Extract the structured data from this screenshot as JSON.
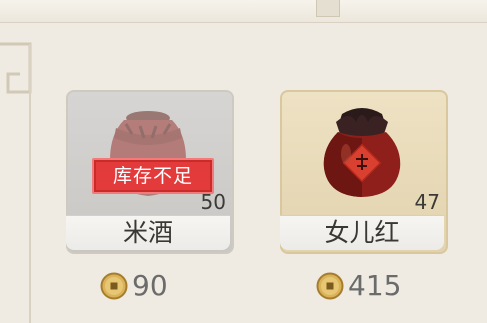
{
  "shop": {
    "items": [
      {
        "name": "米酒",
        "quantity": "50",
        "price": "90",
        "stamp": "库存不足",
        "icon": "rice-wine-jar-icon",
        "out_of_stock": true
      },
      {
        "name": "女儿红",
        "quantity": "47",
        "price": "415",
        "icon": "nuerhong-wine-jar-icon",
        "out_of_stock": false
      }
    ],
    "currency_icon": "copper-coin-icon"
  },
  "colors": {
    "stamp_red": "#e33b3b",
    "jar_red": "#8e1f1a",
    "price_gray": "#6b6b6b",
    "card_disabled": "#d6d5d3",
    "card_active": "#eee2c4"
  }
}
